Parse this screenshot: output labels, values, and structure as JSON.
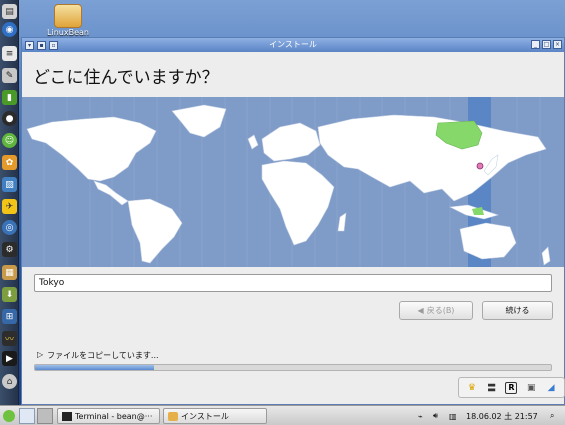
{
  "desktop": {
    "icon_label": "LinuxBean"
  },
  "window": {
    "title": "インストール",
    "heading": "どこに住んでいますか？"
  },
  "map": {
    "selected_region_color": "#86d86a",
    "highlight_color": "#5a86c5"
  },
  "timezone": {
    "value": "Tokyo"
  },
  "buttons": {
    "back": "戻る(B)",
    "continue": "続ける"
  },
  "progress": {
    "label": "ファイルをコピーしています...",
    "fraction": 0.23
  },
  "taskbar": {
    "tasks": [
      {
        "label": "Terminal - bean@···"
      },
      {
        "label": "インストール"
      }
    ],
    "clock": "18.06.02 土 21:57"
  },
  "icons": [
    "start-icon",
    "workspace-icon",
    "terminal-icon",
    "installer-icon",
    "network-icon",
    "volume-icon",
    "calendar-icon",
    "search-icon",
    "crown-icon",
    "clip-icon",
    "registered-icon",
    "keyboard-icon",
    "eraser-icon"
  ]
}
